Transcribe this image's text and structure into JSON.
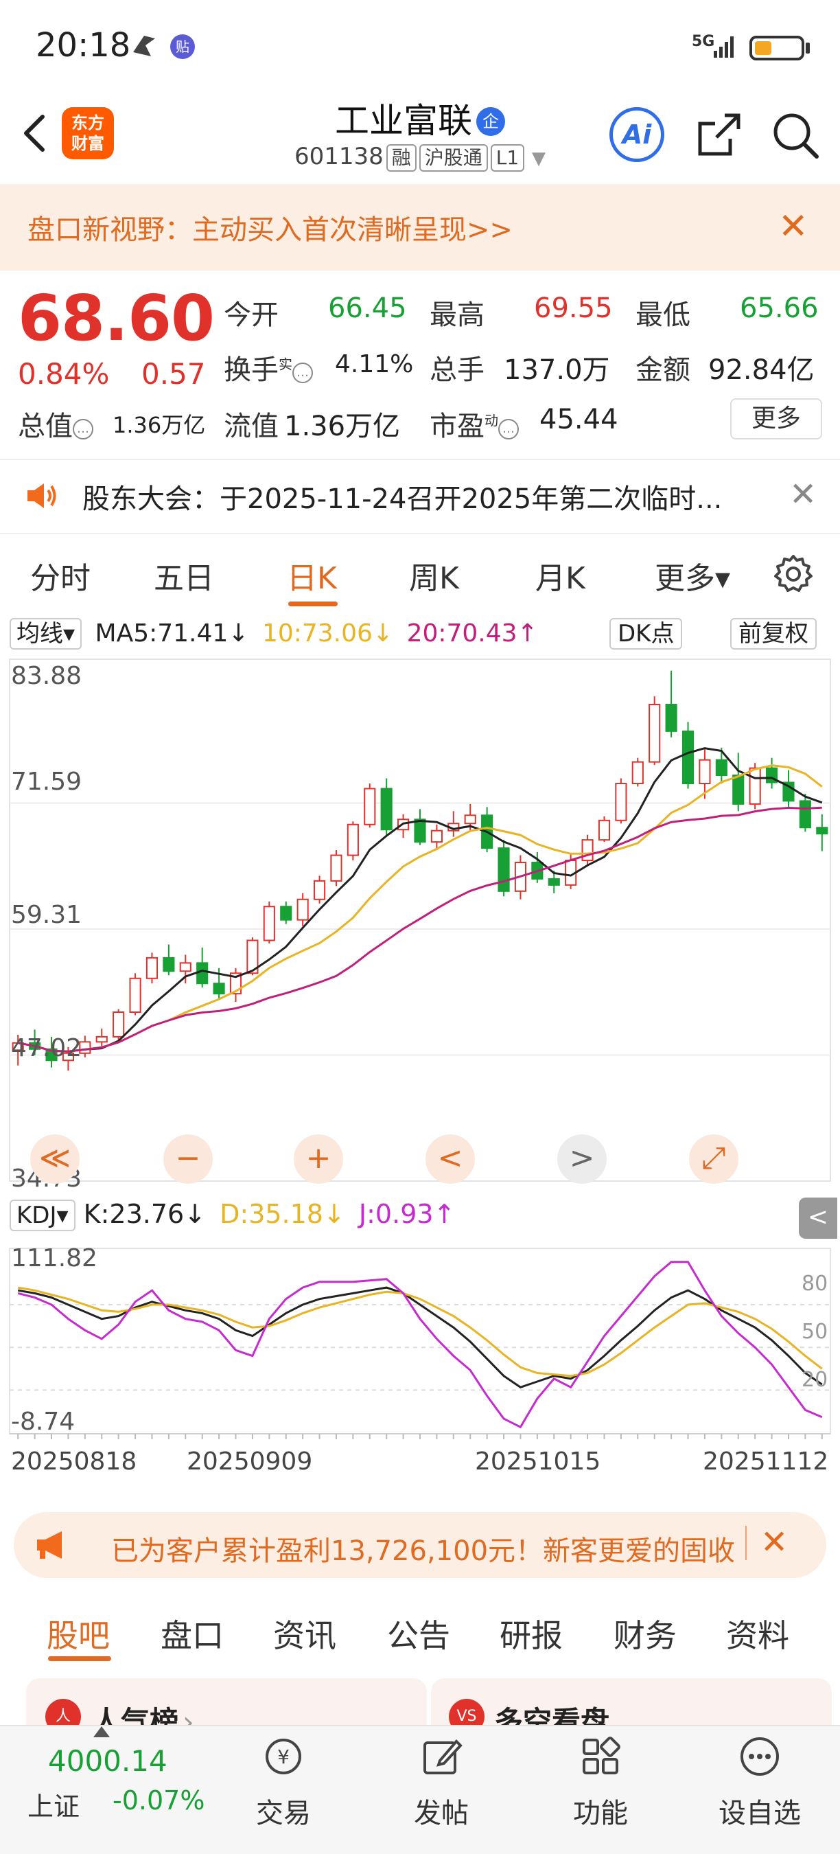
{
  "status_bar": {
    "time": "20:18",
    "network": "5G",
    "badge": "贴"
  },
  "header": {
    "logo": "东方\n财富",
    "title": "工业富联",
    "title_badge": "企",
    "code": "601138",
    "tags": [
      "融",
      "沪股通",
      "L1"
    ],
    "ai_label": "Ai"
  },
  "promo_banner": {
    "text": "盘口新视野：主动买入首次清晰呈现>>",
    "close": "✕"
  },
  "quote": {
    "price": "68.60",
    "change_pct": "0.84%",
    "change": "0.57",
    "open_label": "今开",
    "open": "66.45",
    "high_label": "最高",
    "high": "69.55",
    "low_label": "最低",
    "low": "65.66",
    "turnover_label": "换手",
    "turnover_sup": "实",
    "turnover": "4.11%",
    "volume_label": "总手",
    "volume": "137.0万",
    "amount_label": "金额",
    "amount": "92.84亿",
    "mktcap_label": "总值",
    "mktcap": "1.36万亿",
    "float_label": "流值",
    "float": "1.36万亿",
    "pe_label": "市盈",
    "pe_sup": "动",
    "pe": "45.44",
    "more": "更多"
  },
  "notice": {
    "text": "股东大会：于2025-11-24召开2025年第二次临时...",
    "close": "✕"
  },
  "chart_tabs": [
    "分时",
    "五日",
    "日K",
    "周K",
    "月K",
    "更多▾"
  ],
  "ma": {
    "select": "均线▾",
    "ma5": "MA5:71.41↓",
    "ma10": "10:73.06↓",
    "ma20": "20:70.43↑",
    "dk": "DK点",
    "adjust": "前复权"
  },
  "price_axis": [
    "83.88",
    "71.59",
    "59.31",
    "47.02",
    "34.73"
  ],
  "controls": [
    "≪",
    "−",
    "+",
    "<",
    ">",
    "⤢"
  ],
  "kdj": {
    "select": "KDJ▾",
    "k": "K:23.76↓",
    "d": "D:35.18↓",
    "j": "J:0.93↑",
    "axis": [
      "111.82",
      "-8.74"
    ],
    "levels": [
      "80",
      "50",
      "20"
    ],
    "side_arrow": "<"
  },
  "dates": [
    "20250818",
    "20250909",
    "20251015",
    "20251112"
  ],
  "promo2": {
    "text": "已为客户累计盈利13,726,100元！新客更爱的固收",
    "close": "✕"
  },
  "feed_tabs": [
    "股吧",
    "盘口",
    "资讯",
    "公告",
    "研报",
    "财务",
    "资料"
  ],
  "cards": [
    {
      "title": "人气榜",
      "icon": "人",
      "arrow": "›"
    },
    {
      "title": "多空看盘",
      "icon": "VS"
    }
  ],
  "index": {
    "value": "4000.14",
    "name": "上证",
    "pct": "-0.07%"
  },
  "bottom_nav": [
    "交易",
    "发帖",
    "功能",
    "设自选"
  ],
  "colors": {
    "up": "#e0322b",
    "down": "#17a034",
    "accent": "#e06a20",
    "ma5": "#222222",
    "ma10": "#e8b424",
    "ma20": "#c0207a",
    "k": "#222222",
    "d": "#e8b424",
    "j": "#c62bd0"
  },
  "chart_data": {
    "type": "candlestick",
    "ylim": [
      34.73,
      83.88
    ],
    "candles": [
      [
        47.5,
        49.0,
        46.0,
        48.2
      ],
      [
        48.2,
        49.5,
        47.0,
        47.6
      ],
      [
        47.6,
        48.8,
        45.8,
        46.5
      ],
      [
        46.5,
        47.8,
        45.5,
        47.2
      ],
      [
        47.2,
        48.9,
        46.8,
        48.3
      ],
      [
        48.3,
        49.6,
        47.9,
        48.8
      ],
      [
        48.8,
        51.5,
        48.5,
        51.2
      ],
      [
        51.2,
        55.0,
        50.9,
        54.5
      ],
      [
        54.5,
        57.0,
        54.0,
        56.5
      ],
      [
        56.5,
        57.8,
        54.8,
        55.2
      ],
      [
        55.2,
        56.8,
        54.0,
        56.0
      ],
      [
        56.0,
        57.5,
        53.6,
        54.0
      ],
      [
        54.0,
        55.5,
        52.5,
        53.0
      ],
      [
        53.0,
        55.5,
        52.2,
        55.0
      ],
      [
        55.0,
        58.5,
        54.8,
        58.2
      ],
      [
        58.2,
        62.0,
        57.9,
        61.5
      ],
      [
        61.5,
        62.0,
        59.8,
        60.2
      ],
      [
        60.2,
        62.8,
        59.6,
        62.2
      ],
      [
        62.2,
        64.5,
        61.8,
        64.0
      ],
      [
        64.0,
        67.0,
        63.5,
        66.5
      ],
      [
        66.5,
        69.8,
        66.0,
        69.5
      ],
      [
        69.5,
        73.5,
        69.2,
        73.0
      ],
      [
        73.0,
        74.0,
        68.5,
        69.0
      ],
      [
        69.0,
        70.5,
        68.2,
        70.0
      ],
      [
        70.0,
        71.0,
        67.5,
        67.8
      ],
      [
        67.8,
        69.5,
        67.0,
        68.9
      ],
      [
        68.9,
        70.8,
        68.3,
        69.6
      ],
      [
        69.6,
        71.5,
        68.8,
        70.4
      ],
      [
        70.4,
        71.2,
        66.8,
        67.2
      ],
      [
        67.2,
        68.0,
        62.5,
        63.0
      ],
      [
        63.0,
        66.5,
        62.2,
        65.8
      ],
      [
        65.8,
        66.8,
        63.8,
        64.2
      ],
      [
        64.2,
        65.0,
        62.8,
        63.6
      ],
      [
        63.6,
        66.6,
        63.2,
        66.0
      ],
      [
        66.0,
        68.5,
        65.5,
        68.0
      ],
      [
        68.0,
        70.3,
        67.8,
        69.9
      ],
      [
        69.9,
        74.0,
        69.6,
        73.5
      ],
      [
        73.5,
        76.0,
        73.2,
        75.6
      ],
      [
        75.6,
        82.0,
        75.3,
        81.2
      ],
      [
        81.2,
        84.5,
        78.0,
        78.6
      ],
      [
        78.6,
        79.5,
        73.0,
        73.5
      ],
      [
        73.5,
        77.0,
        72.0,
        75.8
      ],
      [
        75.8,
        77.0,
        73.5,
        74.3
      ],
      [
        74.3,
        76.5,
        70.8,
        71.5
      ],
      [
        71.5,
        75.5,
        71.0,
        75.0
      ],
      [
        75.0,
        76.0,
        73.0,
        73.6
      ],
      [
        73.6,
        74.8,
        71.2,
        71.8
      ],
      [
        71.8,
        72.5,
        68.8,
        69.2
      ],
      [
        69.2,
        70.5,
        66.9,
        68.6
      ]
    ],
    "kdj_ylim": [
      -8.74,
      111.82
    ],
    "k_series": [
      90,
      88,
      85,
      80,
      75,
      70,
      72,
      78,
      82,
      79,
      76,
      74,
      70,
      62,
      58,
      66,
      74,
      80,
      84,
      86,
      88,
      90,
      92,
      88,
      80,
      72,
      64,
      54,
      42,
      30,
      22,
      26,
      30,
      28,
      34,
      44,
      55,
      65,
      76,
      85,
      90,
      84,
      76,
      70,
      64,
      55,
      44,
      32,
      24
    ],
    "d_series": [
      92,
      90,
      87,
      84,
      80,
      76,
      75,
      77,
      80,
      80,
      78,
      76,
      73,
      68,
      64,
      65,
      69,
      74,
      78,
      81,
      84,
      87,
      89,
      88,
      84,
      78,
      72,
      64,
      55,
      45,
      36,
      32,
      31,
      30,
      32,
      38,
      46,
      55,
      64,
      72,
      80,
      81,
      78,
      75,
      70,
      63,
      54,
      44,
      35
    ],
    "j_series": [
      88,
      85,
      80,
      70,
      62,
      56,
      66,
      82,
      90,
      76,
      70,
      68,
      62,
      48,
      44,
      70,
      84,
      92,
      96,
      96,
      96,
      97,
      98,
      88,
      70,
      56,
      44,
      34,
      16,
      0,
      -6,
      14,
      28,
      22,
      40,
      58,
      72,
      86,
      100,
      110,
      110,
      90,
      72,
      60,
      50,
      38,
      22,
      6,
      1
    ]
  }
}
